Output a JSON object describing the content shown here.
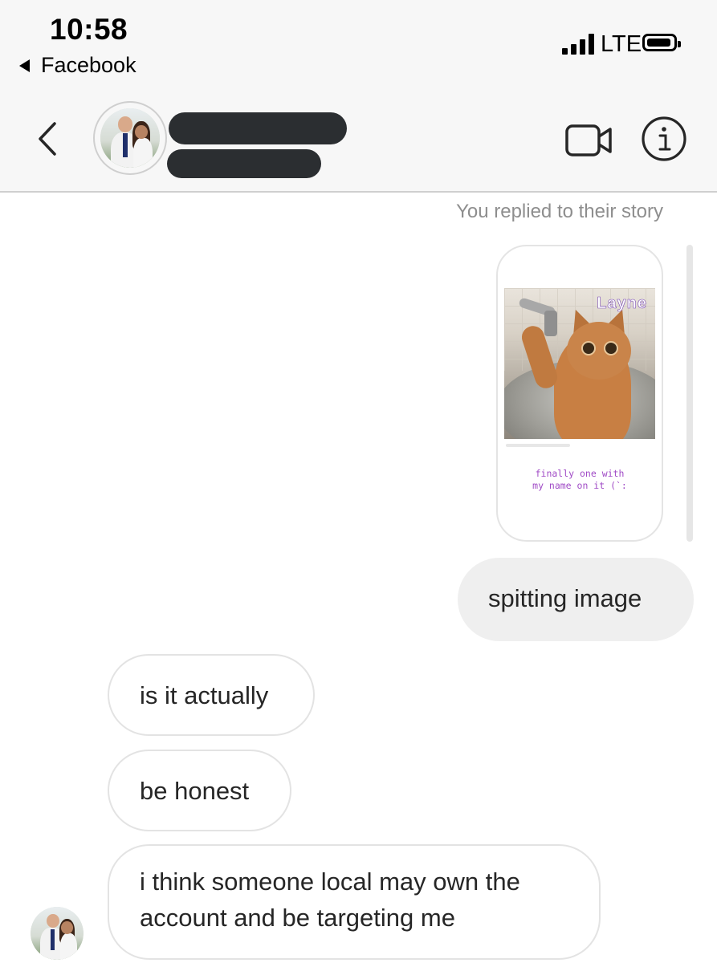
{
  "status_bar": {
    "time": "10:58",
    "back_app": "Facebook",
    "network": "LTE"
  },
  "header": {
    "contact_name_redacted": true,
    "icons": {
      "back": "chevron-left-icon",
      "video": "video-camera-icon",
      "info": "info-icon"
    }
  },
  "chat": {
    "story_reply_note": "You replied to their story",
    "story": {
      "label": "Layne",
      "caption_line1": "finally one with",
      "caption_line2": "my name on it (`:"
    },
    "messages": [
      {
        "direction": "outgoing",
        "lines": [
          "spitting image"
        ]
      },
      {
        "direction": "incoming",
        "lines": [
          "is it actually"
        ]
      },
      {
        "direction": "incoming",
        "lines": [
          "be honest"
        ]
      },
      {
        "direction": "incoming",
        "lines": [
          "i think someone local may own the",
          "account and be targeting me"
        ]
      }
    ]
  },
  "colors": {
    "header_bg": "#f7f7f7",
    "outgoing_bubble": "#efefef",
    "incoming_border": "#e3e3e3",
    "meta_text": "#8e8e8e",
    "redaction": "#2b2e31",
    "story_caption": "#a04bc6"
  }
}
